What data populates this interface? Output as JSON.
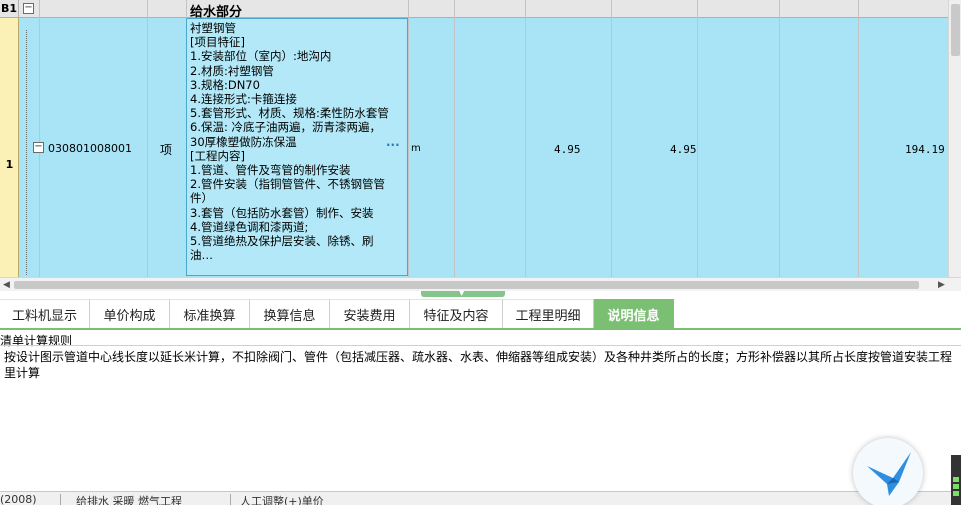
{
  "grid": {
    "header_row": {
      "row_label": "B1",
      "title": "给水部分"
    },
    "row": {
      "number": "1",
      "code": "030801008001",
      "kind": "项",
      "description": "衬塑钢管\n[项目特征]\n1.安装部位（室内）:地沟内\n2.材质:衬塑钢管\n3.规格:DN70\n4.连接形式:卡箍连接\n5.套管形式、材质、规格:柔性防水套管\n6.保温: 冷底子油两遍，沥青漆两遍，30厚橡塑做防冻保温\n[工程内容]\n1.管道、管件及弯管的制作安装\n2.管件安装（指铜管管件、不锈钢管管件）\n3.套管（包括防水套管）制作、安装\n4.管道绿色调和漆两道;\n5.管道绝热及保护层安装、除锈、刷油…",
      "more": "···",
      "unit": "m",
      "qty1": "4.95",
      "qty2": "4.95",
      "amount": "194.19"
    }
  },
  "tabs": [
    {
      "label": "工料机显示"
    },
    {
      "label": "单价构成"
    },
    {
      "label": "标准换算"
    },
    {
      "label": "换算信息"
    },
    {
      "label": "安装费用"
    },
    {
      "label": "特征及内容"
    },
    {
      "label": "工程里明细"
    },
    {
      "label": "说明信息"
    }
  ],
  "active_tab": "说明信息",
  "rule_panel": {
    "header": "清单计算规则",
    "text": "按设计图示管道中心线长度以延长米计算，不扣除阀门、管件（包括减压器、疏水器、水表、伸缩器等组成安装）及各种井类所占的长度；方形补偿器以其所占长度按管道安装工程里计算"
  },
  "statusbar": {
    "items": [
      {
        "text": "(2008)"
      },
      {
        "text": "给排水 采暖 燃气工程"
      },
      {
        "text": "人工调整(+)单价"
      }
    ]
  },
  "colors": {
    "row_bg": "#a8e4f5",
    "row_number_bg": "#fbf0b6",
    "tab_active_bg": "#7bbf72"
  }
}
